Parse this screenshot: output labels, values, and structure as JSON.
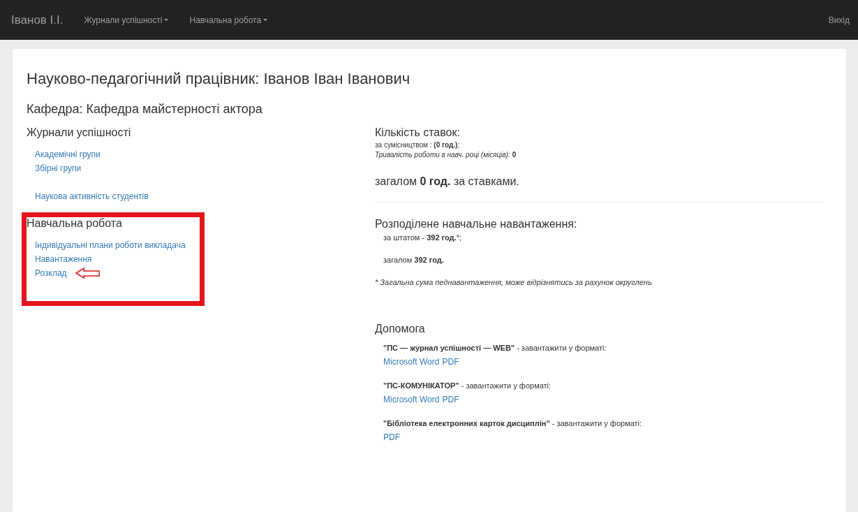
{
  "navbar": {
    "brand": "Іванов І.І.",
    "menus": [
      {
        "label": "Журнали успішності"
      },
      {
        "label": "Навчальна робота"
      }
    ],
    "logout": "Вихід"
  },
  "page": {
    "title": "Науково-педагогічний працівник: Іванов Іван Іванович",
    "department": "Кафедра: Кафедра майстерності актора"
  },
  "sidebar": {
    "sections": [
      {
        "heading": "Журнали успішності",
        "highlighted": false,
        "groups": [
          [
            {
              "label": "Академічні групи",
              "pointed": false
            },
            {
              "label": "Збірні групи",
              "pointed": false
            }
          ],
          [
            {
              "label": "Наукова активність студентів",
              "pointed": false
            }
          ]
        ]
      },
      {
        "heading": "Навчальна робота",
        "highlighted": true,
        "groups": [
          [
            {
              "label": "Індивідуальні плани роботи викладача",
              "pointed": false
            },
            {
              "label": "Навантаження",
              "pointed": false
            },
            {
              "label": "Розклад",
              "pointed": true
            }
          ]
        ]
      }
    ]
  },
  "rates": {
    "heading": "Кількість ставок:",
    "lines": [
      "за сумісництвом : **(0 год.)**;",
      "*Тривалість роботи в навч. році (місяців):* **0**"
    ],
    "total": "загалом **0 год.** за ставками."
  },
  "load": {
    "heading": "Розподілене навчальне навантаження:",
    "lines": [
      {
        "before": "за штатом - ",
        "bold": "392 год.",
        "after": "*;"
      },
      {
        "before": "загалом ",
        "bold": "392 год."
      }
    ],
    "footnote": "* Загальна сума педнавантаження, може відрізнятись за рахунок округлень"
  },
  "help": {
    "heading": "Допомога",
    "items": [
      {
        "title": "\"ПС — журнал успішності — WEB\"",
        "note": " - завантажити у форматі:",
        "links": [
          "Microsoft Word",
          "PDF"
        ]
      },
      {
        "title": "\"ПС-КОМУНІКАТОР\"",
        "note": " - завантажити у форматі:",
        "links": [
          "Microsoft Word",
          "PDF"
        ]
      },
      {
        "title": "\"Бібліотека електронних карток дисциплін\"",
        "note": " - завантажити у форматі:",
        "links": [
          "PDF"
        ]
      }
    ]
  }
}
